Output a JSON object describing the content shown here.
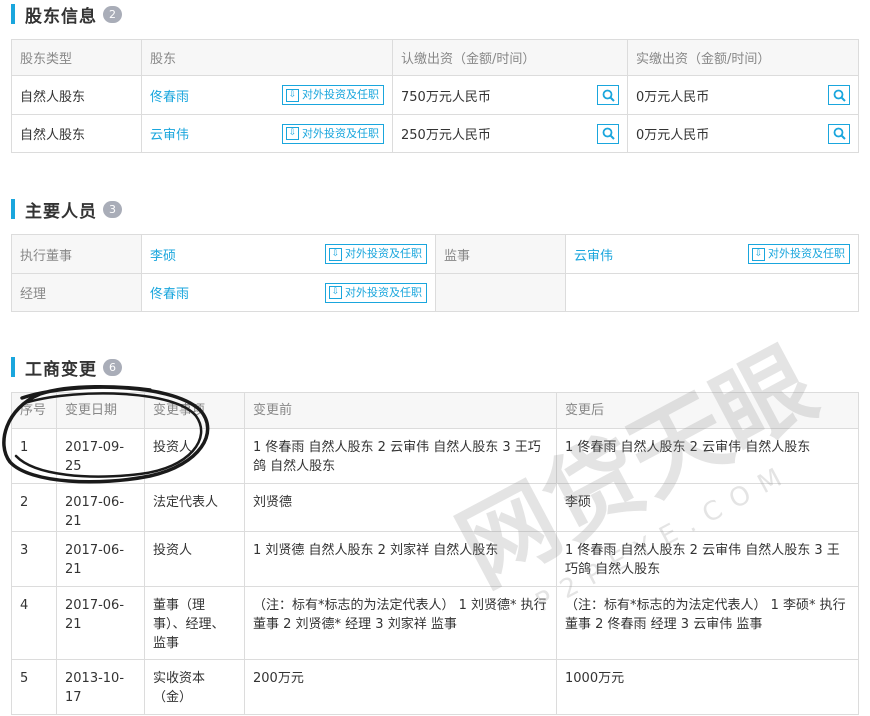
{
  "shareholders": {
    "title": "股东信息",
    "count": "2",
    "headers": [
      "股东类型",
      "股东",
      "认缴出资（金额/时间）",
      "实缴出资（金额/时间）"
    ],
    "rows": [
      {
        "type": "自然人股东",
        "name": "佟春雨",
        "button": "对外投资及任职",
        "subscribed": "750万元人民币",
        "paid": "0万元人民币"
      },
      {
        "type": "自然人股东",
        "name": "云审伟",
        "button": "对外投资及任职",
        "subscribed": "250万元人民币",
        "paid": "0万元人民币"
      }
    ]
  },
  "personnel": {
    "title": "主要人员",
    "count": "3",
    "rows": [
      {
        "role1": "执行董事",
        "name1": "李硕",
        "button1": "对外投资及任职",
        "role2": "监事",
        "name2": "云审伟",
        "button2": "对外投资及任职"
      },
      {
        "role1": "经理",
        "name1": "佟春雨",
        "button1": "对外投资及任职",
        "role2": "",
        "name2": "",
        "button2": ""
      }
    ]
  },
  "changes": {
    "title": "工商变更",
    "count": "6",
    "headers": [
      "序号",
      "变更日期",
      "变更事项",
      "变更前",
      "变更后"
    ],
    "rows": [
      {
        "no": "1",
        "date": "2017-09-25",
        "item": "投资人",
        "before": "1 佟春雨 自然人股东 2 云审伟 自然人股东 3 王巧鸽 自然人股东",
        "after": "1 佟春雨 自然人股东 2 云审伟 自然人股东"
      },
      {
        "no": "2",
        "date": "2017-06-21",
        "item": "法定代表人",
        "before": "刘贤德",
        "after": "李硕"
      },
      {
        "no": "3",
        "date": "2017-06-21",
        "item": "投资人",
        "before": "1 刘贤德 自然人股东 2 刘家祥 自然人股东",
        "after": "1 佟春雨 自然人股东 2 云审伟 自然人股东 3 王巧鸽 自然人股东"
      },
      {
        "no": "4",
        "date": "2017-06-21",
        "item": "董事（理事）、经理、监事",
        "before": "（注：标有*标志的为法定代表人） 1 刘贤德* 执行董事 2 刘贤德* 经理 3 刘家祥 监事",
        "after": "（注：标有*标志的为法定代表人） 1 李硕* 执行董事 2 佟春雨 经理 3 云审伟 监事"
      },
      {
        "no": "5",
        "date": "2013-10-17",
        "item": "实收资本（金）",
        "before": "200万元",
        "after": "1000万元"
      }
    ]
  },
  "watermark": {
    "text": "网贷天眼",
    "subtext": "P2PEYE.COM"
  },
  "colors": {
    "accent": "#1aa6dd",
    "border": "#dcdcdc",
    "header_bg": "#f7f7f7",
    "badge": "#a9adb8"
  }
}
